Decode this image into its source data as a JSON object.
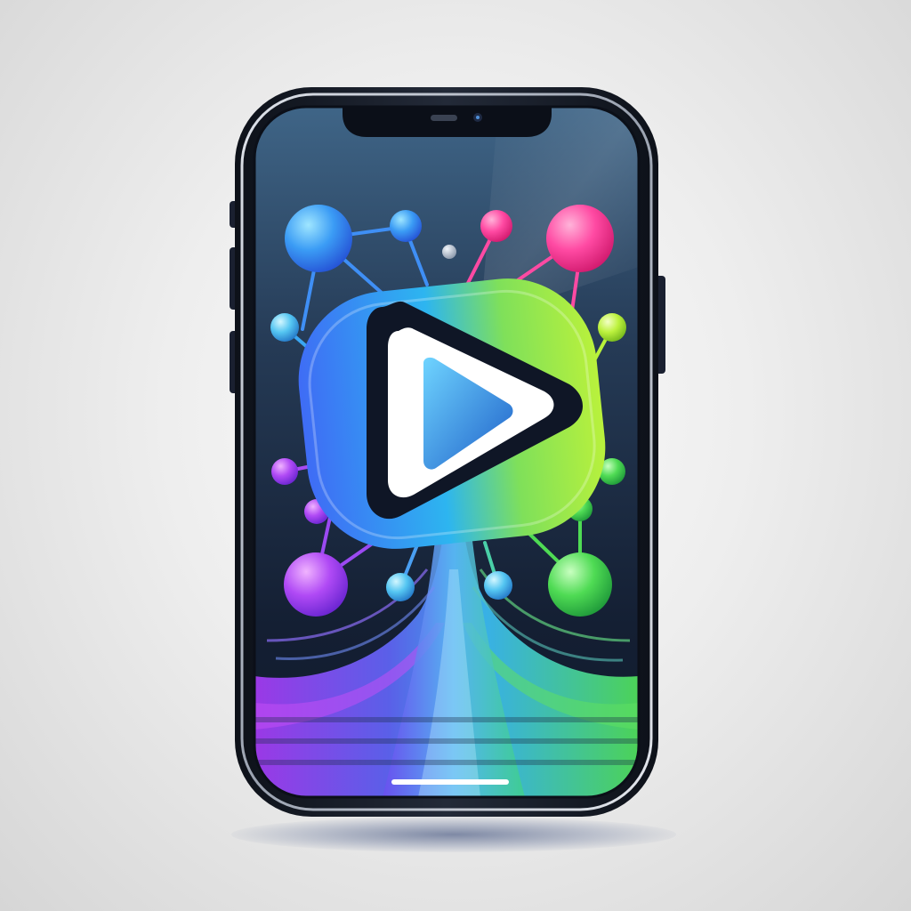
{
  "illustration": {
    "subject": "smartphone",
    "screen_icon": "play-icon",
    "decorations": [
      "network-node-icon",
      "connection-line-icon",
      "light-stream-icon"
    ]
  },
  "colors": {
    "background": "#ececec",
    "phone_frame": "#1b2130",
    "screen_top": "#3a5a7c",
    "screen_bottom": "#101a2c",
    "accent_blue": "#2f7cf2",
    "accent_cyan": "#45c3f2",
    "accent_purple": "#9b3df0",
    "accent_pink": "#ff3a9e",
    "accent_green": "#4fd94a",
    "accent_lime": "#b8f23a",
    "play_button": "#ffffff"
  }
}
